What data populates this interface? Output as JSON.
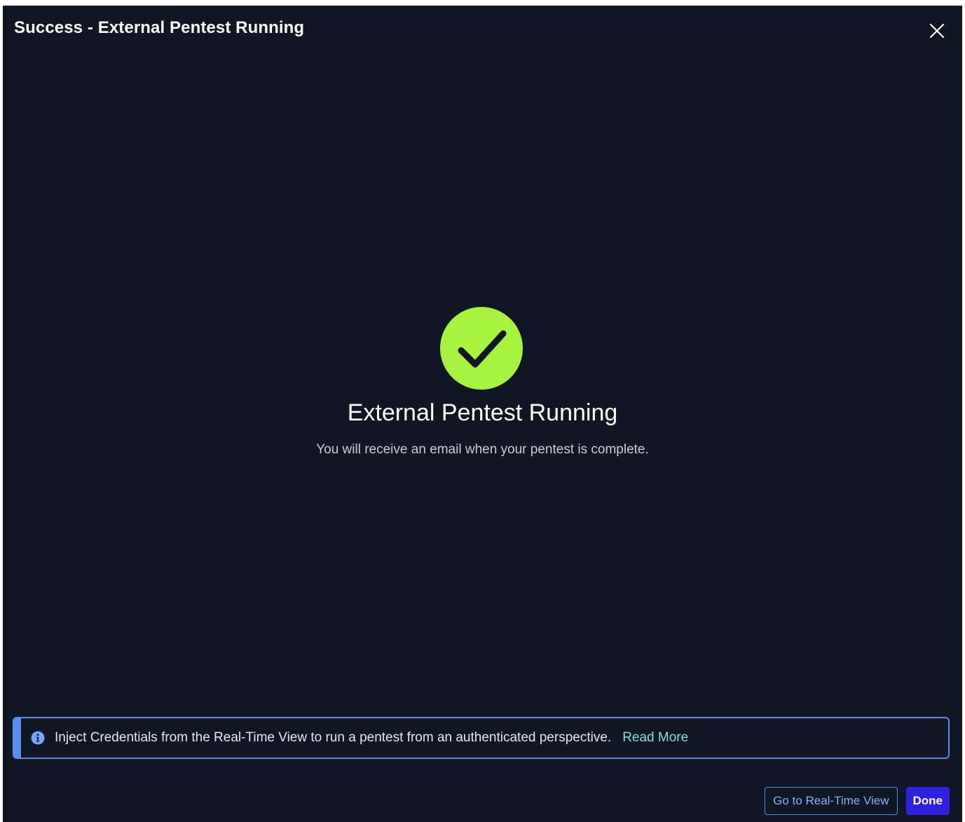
{
  "dialog": {
    "title": "Success - External Pentest Running",
    "close_icon": "close-icon"
  },
  "main": {
    "status_icon": "check-circle-icon",
    "heading": "External Pentest Running",
    "subtext": "You will receive an email when your pentest is complete."
  },
  "banner": {
    "icon": "info-icon",
    "text": "Inject Credentials from the Real-Time View to run a pentest from an authenticated perspective.",
    "link_label": "Read More"
  },
  "footer": {
    "secondary_label": "Go to Real-Time View",
    "primary_label": "Done"
  },
  "colors": {
    "background": "#101624",
    "success": "#a6f23f",
    "accent_blue": "#5b8ee8",
    "link_teal": "#7fe0d8",
    "primary_button": "#2f1fe0"
  }
}
